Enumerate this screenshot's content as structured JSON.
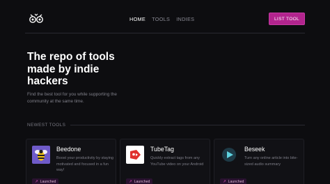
{
  "nav": {
    "items": [
      {
        "label": "HOME",
        "active": true
      },
      {
        "label": "TOOLS",
        "active": false
      },
      {
        "label": "INDIES",
        "active": false
      }
    ],
    "cta_label": "LIST TOOL"
  },
  "colors": {
    "accent": "#b2248e",
    "background": "#0d0d10"
  },
  "hero": {
    "title": "The repo of tools made by indie hackers",
    "subtitle": "Find the best tool for you while supporting the community at the same time."
  },
  "newest": {
    "label": "NEWEST TOOLS",
    "tools": [
      {
        "name": "Beedone",
        "description": "Boost your productivity by staying motivated and focused in a fun way!",
        "status": "Launched",
        "icon": "bee-icon"
      },
      {
        "name": "TubeTag",
        "description": "Quickly extract tags from any YouTube video on your Android",
        "status": "Launched",
        "icon": "tag-icon"
      },
      {
        "name": "Beseek",
        "description": "Turn any online article into bite-sized audio summary",
        "status": "Launched",
        "icon": "play-icon"
      }
    ]
  }
}
